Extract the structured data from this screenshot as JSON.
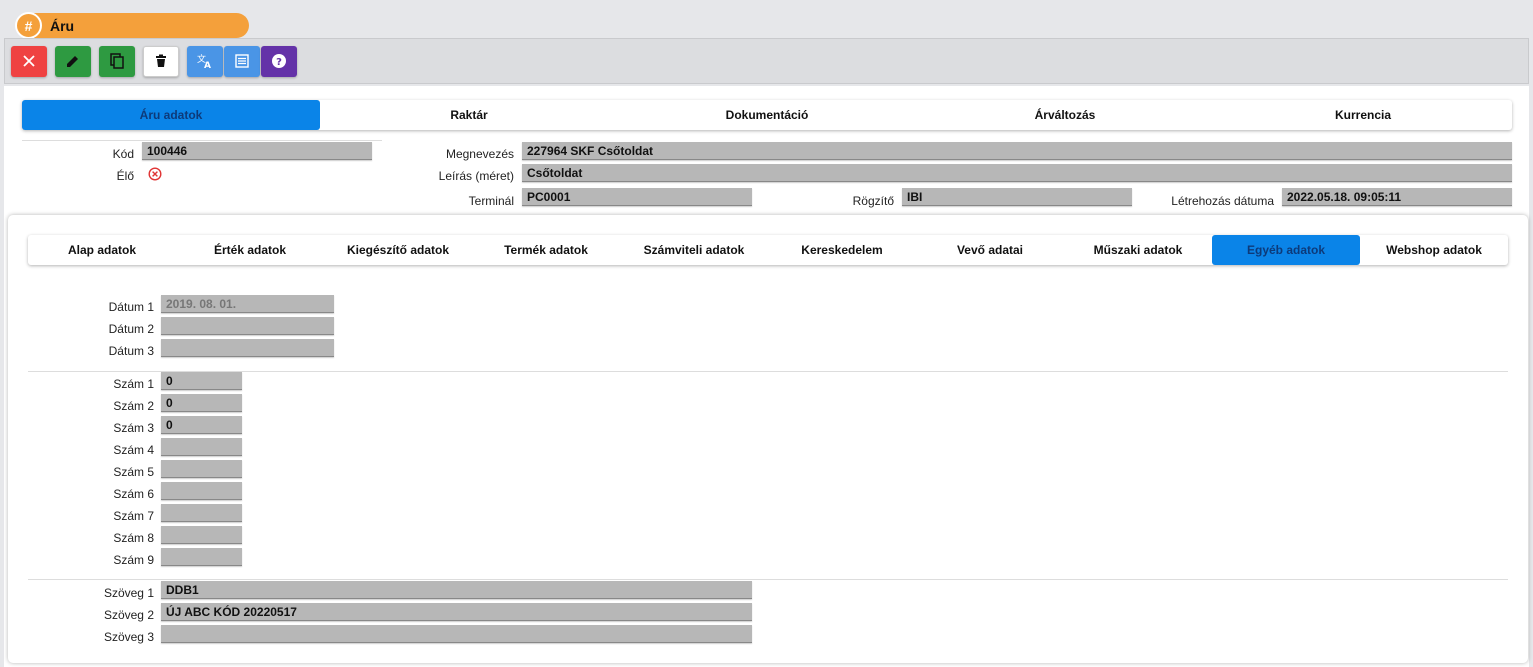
{
  "window": {
    "title": "Áru",
    "title_icon": "#"
  },
  "toolbar": {
    "buttons": [
      {
        "name": "close-button",
        "icon": "close-icon",
        "color": "#ef4242"
      },
      {
        "name": "edit-button",
        "icon": "pencil-icon",
        "color": "#2e9a41"
      },
      {
        "name": "copy-button",
        "icon": "copy-icon",
        "color": "#2e9a41"
      },
      {
        "name": "delete-button",
        "icon": "trash-icon",
        "color": "#ffffff"
      },
      {
        "name": "translate-button",
        "icon": "translate-icon",
        "color": "#4a95e6"
      },
      {
        "name": "list-button",
        "icon": "list-icon",
        "color": "#4a95e6"
      },
      {
        "name": "help-button",
        "icon": "help-icon",
        "color": "#6432a8"
      }
    ]
  },
  "top_tabs": [
    "Áru adatok",
    "Raktár",
    "Dokumentáció",
    "Árváltozás",
    "Kurrencia"
  ],
  "header": {
    "kod_label": "Kód",
    "kod_value": "100446",
    "elo_label": "Élő",
    "megnevezes_label": "Megnevezés",
    "megnevezes_value": "227964 SKF Csőtoldat",
    "leiras_label": "Leírás (méret)",
    "leiras_value": "Csőtoldat",
    "terminal_label": "Terminál",
    "terminal_value": "PC0001",
    "rogzito_label": "Rögzítő",
    "rogzito_value": "IBI",
    "letrehozas_label": "Létrehozás dátuma",
    "letrehozas_value": "2022.05.18. 09:05:11"
  },
  "inner_tabs": [
    "Alap adatok",
    "Érték adatok",
    "Kiegészítő adatok",
    "Termék adatok",
    "Számviteli adatok",
    "Kereskedelem",
    "Vevő adatai",
    "Műszaki adatok",
    "Egyéb adatok",
    "Webshop adatok"
  ],
  "datum": {
    "labels": [
      "Dátum 1",
      "Dátum 2",
      "Dátum 3"
    ],
    "values": [
      "2019. 08. 01.",
      "",
      ""
    ]
  },
  "szam": {
    "labels": [
      "Szám 1",
      "Szám 2",
      "Szám 3",
      "Szám 4",
      "Szám 5",
      "Szám 6",
      "Szám 7",
      "Szám 8",
      "Szám 9"
    ],
    "values": [
      "0",
      "0",
      "0",
      "",
      "",
      "",
      "",
      "",
      ""
    ]
  },
  "szoveg": {
    "labels": [
      "Szöveg 1",
      "Szöveg 2",
      "Szöveg 3"
    ],
    "values": [
      "DDB1",
      "ÚJ ABC KÓD 20220517",
      ""
    ]
  },
  "colors": {
    "accent": "#0a84e8",
    "title": "#f4a03b",
    "field": "#b7b7b7"
  }
}
